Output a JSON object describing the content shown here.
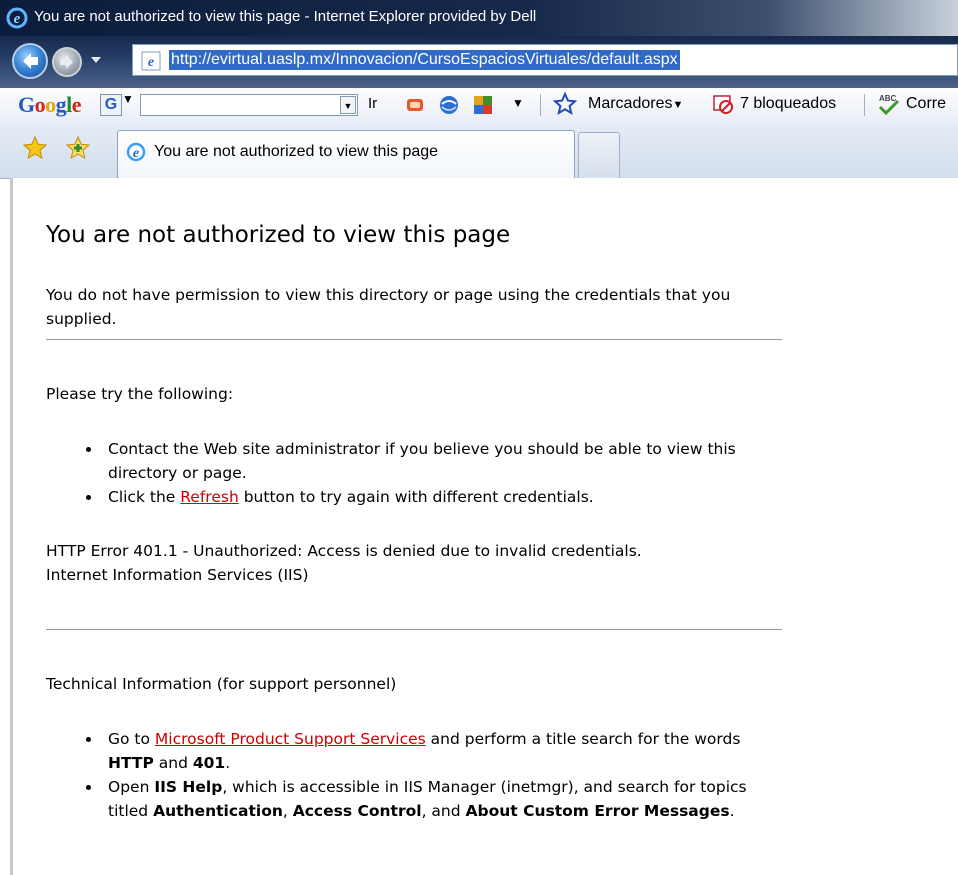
{
  "window": {
    "title": "You are not authorized to view this page - Internet Explorer provided by Dell"
  },
  "address_bar": {
    "url": "http://evirtual.uaslp.mx/Innovacion/CursoEspaciosVirtuales/default.aspx"
  },
  "google_toolbar": {
    "logo": "Google",
    "g_button": "G",
    "ir_label": "Ir",
    "bookmarks_label": "Marcadores",
    "blocked_label": "7 bloqueados",
    "spell_label": "Corre"
  },
  "tabs": [
    {
      "label": "You are not authorized to view this page",
      "active": true
    }
  ],
  "page": {
    "heading": "You are not authorized to view this page",
    "intro": "You do not have permission to view this directory or page using the credentials that you supplied.",
    "try_heading": "Please try the following:",
    "try_item_1": "Contact the Web site administrator if you believe you should be able to view this directory or page.",
    "try_item_2_pre": "Click the ",
    "try_item_2_link": "Refresh",
    "try_item_2_post": " button to try again with different credentials.",
    "error_line": "HTTP Error 401.1 - Unauthorized: Access is denied due to invalid credentials.",
    "server_line": "Internet Information Services (IIS)",
    "tech_heading": "Technical Information (for support personnel)",
    "tech_item_1_pre": "Go to ",
    "tech_item_1_link": "Microsoft Product Support Services",
    "tech_item_1_mid": " and perform a title search for the words ",
    "tech_item_1_b1": "HTTP",
    "tech_item_1_and": " and ",
    "tech_item_1_b2": "401",
    "tech_item_1_end": ".",
    "tech_item_2_pre": "Open ",
    "tech_item_2_b1": "IIS Help",
    "tech_item_2_mid": ", which is accessible in IIS Manager (inetmgr), and search for topics titled ",
    "tech_item_2_b2": "Authentication",
    "tech_item_2_sep1": ", ",
    "tech_item_2_b3": "Access Control",
    "tech_item_2_sep2": ", and ",
    "tech_item_2_b4": "About Custom Error Messages",
    "tech_item_2_end": "."
  },
  "colors": {
    "link": "#cc0000",
    "url_highlight": "#3169c6"
  }
}
